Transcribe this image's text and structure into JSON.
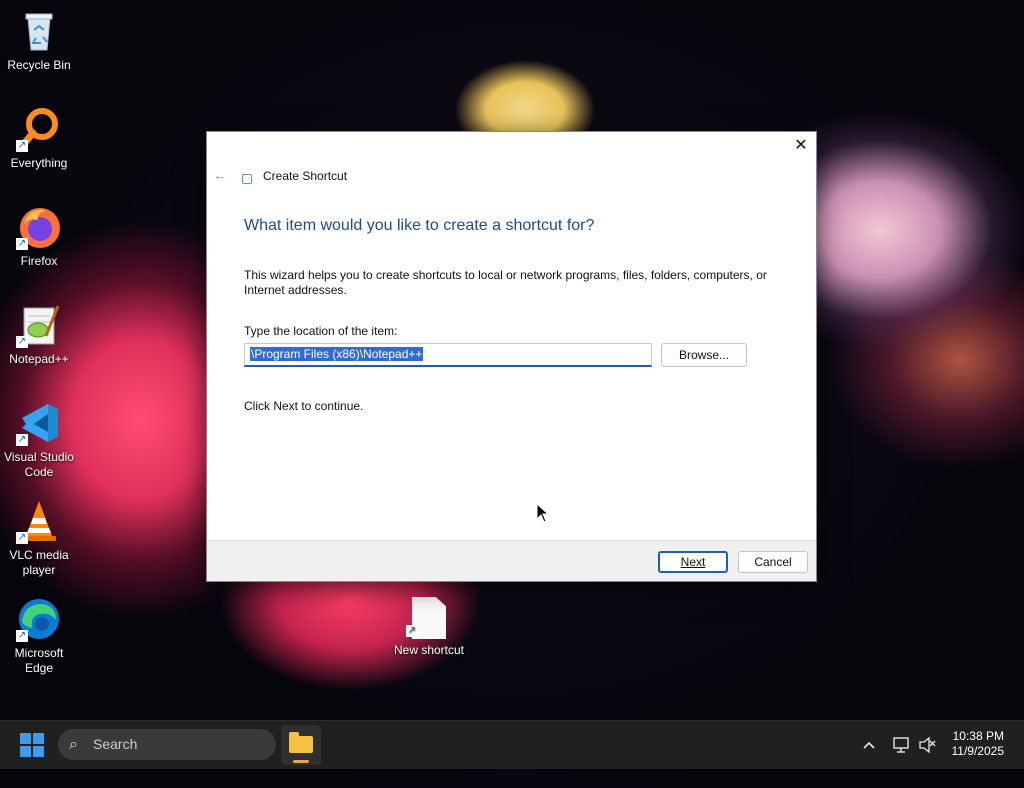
{
  "desktop": {
    "icons": [
      {
        "label": "Recycle Bin",
        "icon": "recycle-bin-icon"
      },
      {
        "label": "Everything",
        "icon": "everything-search-icon"
      },
      {
        "label": "Firefox",
        "icon": "firefox-icon"
      },
      {
        "label": "Notepad++",
        "icon": "notepad-plus-plus-icon"
      },
      {
        "label": "Visual Studio Code",
        "icon": "vscode-icon"
      },
      {
        "label": "VLC media player",
        "icon": "vlc-icon"
      },
      {
        "label": "Microsoft Edge",
        "icon": "edge-icon"
      }
    ],
    "new_shortcut_label": "New shortcut"
  },
  "dialog": {
    "window_title": "Create Shortcut",
    "heading": "What item would you like to create a shortcut for?",
    "description": "This wizard helps you to create shortcuts to local or network programs, files, folders, computers, or Internet addresses.",
    "location_label": "Type the location of the item:",
    "location_value": "\\Program Files (x86)\\Notepad++",
    "browse_label": "Browse...",
    "hint": "Click Next to continue.",
    "next_label": "Next",
    "cancel_label": "Cancel",
    "close_glyph": "✕",
    "back_glyph": "←"
  },
  "taskbar": {
    "search_placeholder": "Search",
    "time": "10:38 PM",
    "date": "11/9/2025",
    "tray_chevron": "^"
  },
  "colors": {
    "accent": "#1a5fb4",
    "heading": "#1b4b9b",
    "taskbar_bg": "#202020"
  }
}
